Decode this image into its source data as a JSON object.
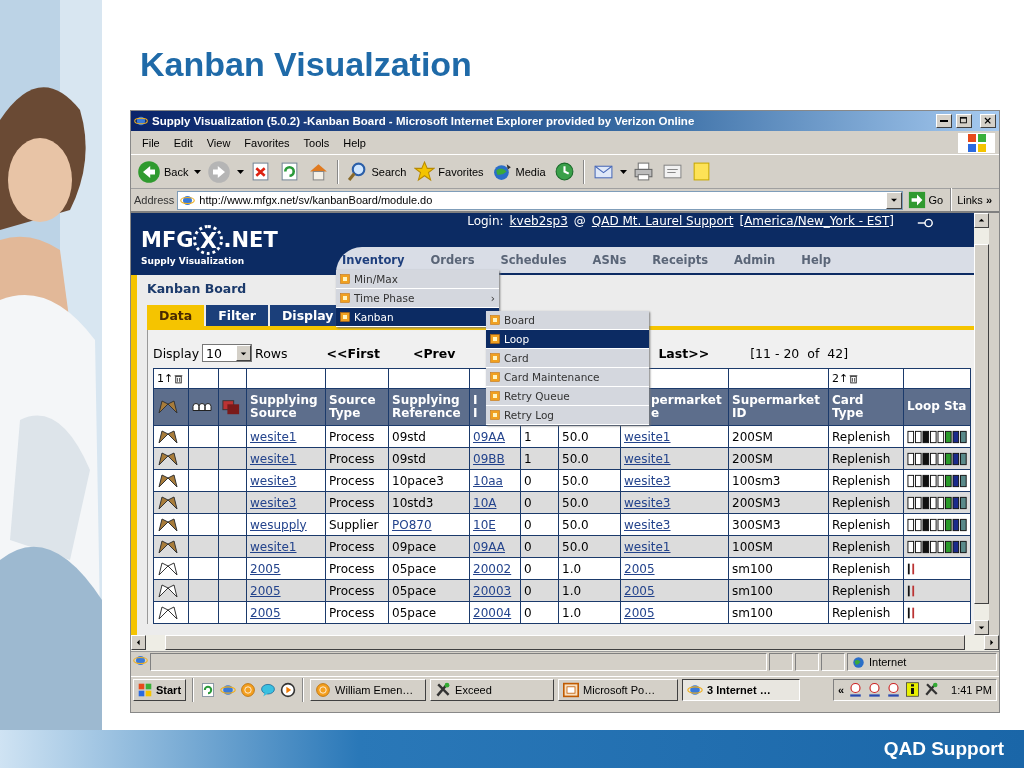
{
  "slide": {
    "title": "Kanban Visualzation",
    "footer": "QAD Support"
  },
  "browser": {
    "title": "Supply Visualization (5.0.2) -Kanban Board - Microsoft Internet Explorer provided by Verizon Online",
    "menu": [
      "File",
      "Edit",
      "View",
      "Favorites",
      "Tools",
      "Help"
    ],
    "toolbar": [
      {
        "kind": "back",
        "label": "Back",
        "dropdown": true
      },
      {
        "kind": "forward",
        "dropdown": true
      },
      {
        "kind": "stop"
      },
      {
        "kind": "refresh"
      },
      {
        "kind": "home"
      },
      {
        "kind": "search",
        "label": "Search"
      },
      {
        "kind": "favorites",
        "label": "Favorites"
      },
      {
        "kind": "media",
        "label": "Media"
      },
      {
        "kind": "history"
      },
      {
        "kind": "mail",
        "dropdown": true
      },
      {
        "kind": "print"
      },
      {
        "kind": "edit"
      },
      {
        "kind": "note"
      }
    ],
    "address": {
      "label": "Address",
      "value": "http://www.mfgx.net/sv/kanbanBoard/module.do",
      "go": "Go",
      "links": "Links",
      "more": "»"
    },
    "status": {
      "zone": "Internet"
    }
  },
  "app": {
    "logo": {
      "left": "MFG",
      "center": "X",
      "right": ".NET"
    },
    "subtitle": "Supply Visualization",
    "login": {
      "label": "Login:",
      "user": "kveb2sp3",
      "at": "@",
      "site": "QAD Mt. Laurel Support",
      "timezone": "[America/New_York - EST]"
    },
    "nav": [
      {
        "label": "Inventory",
        "selected": true
      },
      {
        "label": "Orders",
        "selected": false
      },
      {
        "label": "Schedules",
        "selected": false
      },
      {
        "label": "ASNs",
        "selected": false
      },
      {
        "label": "Receipts",
        "selected": false
      },
      {
        "label": "Admin",
        "selected": false
      },
      {
        "label": "Help",
        "selected": false
      }
    ],
    "menu": [
      {
        "label": "Min/Max",
        "selected": false
      },
      {
        "label": "Time Phase",
        "selected": false,
        "arrow": "›"
      },
      {
        "label": "Kanban",
        "selected": true
      }
    ],
    "submenu": [
      {
        "label": "Board",
        "selected": false
      },
      {
        "label": "Loop",
        "selected": true
      },
      {
        "label": "Card",
        "selected": false
      },
      {
        "label": "Card Maintenance",
        "selected": false
      },
      {
        "label": "Retry Queue",
        "selected": false
      },
      {
        "label": "Retry Log",
        "selected": false
      }
    ],
    "page_title": "Kanban Board",
    "tabs": [
      {
        "label": "Data",
        "selected": true
      },
      {
        "label": "Filter",
        "selected": false
      },
      {
        "label": "Display",
        "selected": false
      }
    ],
    "pager": {
      "display": "Display",
      "rows_value": "10",
      "rows": "Rows",
      "first": "<<First",
      "prev": "<Prev",
      "last": "Last>>",
      "range": "[11 - 20  of  42]"
    },
    "icon_columns": [
      {
        "kind": "flags",
        "sort": "1↑"
      },
      {
        "kind": "people"
      },
      {
        "kind": "cards"
      }
    ],
    "columns": [
      {
        "lines": [
          "Supplying",
          "Source"
        ],
        "link": true
      },
      {
        "lines": [
          "Source",
          "Type"
        ]
      },
      {
        "lines": [
          "Supplying",
          "Reference"
        ]
      },
      {
        "lines": [
          "I",
          "I"
        ],
        "link": true
      },
      {},
      {},
      {
        "lines": [
          "permarket",
          "e"
        ],
        "link": true
      },
      {
        "lines": [
          "Supermarket",
          "ID"
        ]
      },
      {
        "lines": [
          "Card",
          "Type"
        ],
        "sort": "2↑"
      },
      {
        "lines": [
          "Loop Sta"
        ]
      }
    ],
    "rows": [
      {
        "active": true,
        "reference_link": false,
        "cells": [
          "wesite1",
          "Process",
          "09std",
          "09AA",
          "1",
          "50.0",
          "wesite1",
          "200SM",
          "Replenish"
        ]
      },
      {
        "active": true,
        "reference_link": false,
        "cells": [
          "wesite1",
          "Process",
          "09std",
          "09BB",
          "1",
          "50.0",
          "wesite1",
          "200SM",
          "Replenish"
        ]
      },
      {
        "active": true,
        "reference_link": false,
        "cells": [
          "wesite3",
          "Process",
          "10pace3",
          "10aa",
          "0",
          "50.0",
          "wesite3",
          "100sm3",
          "Replenish"
        ]
      },
      {
        "active": true,
        "reference_link": false,
        "cells": [
          "wesite3",
          "Process",
          "10std3",
          "10A",
          "0",
          "50.0",
          "wesite3",
          "200SM3",
          "Replenish"
        ]
      },
      {
        "active": true,
        "reference_link": true,
        "cells": [
          "wesupply",
          "Supplier",
          "PO870",
          "10E",
          "0",
          "50.0",
          "wesite3",
          "300SM3",
          "Replenish"
        ]
      },
      {
        "active": true,
        "reference_link": false,
        "cells": [
          "wesite1",
          "Process",
          "09pace",
          "09AA",
          "0",
          "50.0",
          "wesite1",
          "100SM",
          "Replenish"
        ]
      },
      {
        "active": false,
        "reference_link": false,
        "cells": [
          "2005",
          "Process",
          "05pace",
          "20002",
          "0",
          "1.0",
          "2005",
          "sm100",
          "Replenish"
        ]
      },
      {
        "active": false,
        "reference_link": false,
        "cells": [
          "2005",
          "Process",
          "05pace",
          "20003",
          "0",
          "1.0",
          "2005",
          "sm100",
          "Replenish"
        ]
      },
      {
        "active": false,
        "reference_link": false,
        "cells": [
          "2005",
          "Process",
          "05pace",
          "20004",
          "0",
          "1.0",
          "2005",
          "sm100",
          "Replenish"
        ]
      }
    ]
  },
  "taskbar": {
    "start": "Start",
    "tasks": [
      {
        "label": "William Emen…",
        "selected": false
      },
      {
        "label": "Exceed",
        "selected": false
      },
      {
        "label": "Microsoft Po…",
        "selected": false
      },
      {
        "label": "3 Internet …",
        "selected": true
      }
    ],
    "chevron": "«",
    "clock": "1:41 PM"
  }
}
